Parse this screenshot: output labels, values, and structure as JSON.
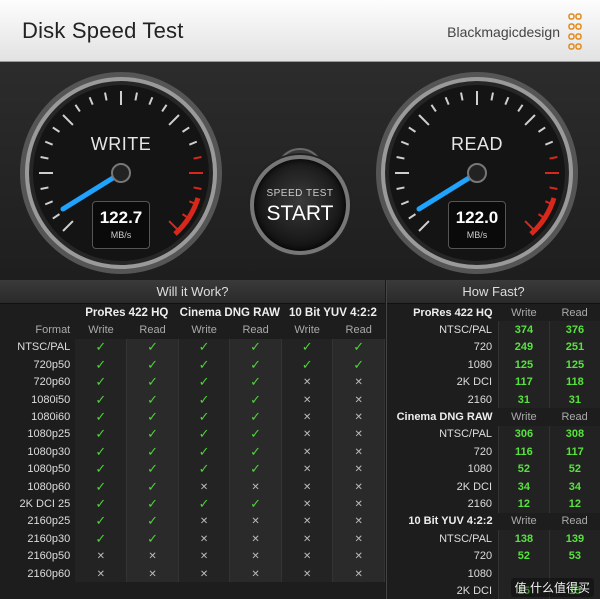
{
  "app": {
    "title": "Disk Speed Test",
    "brand": "Blackmagicdesign"
  },
  "gauges": {
    "write": {
      "label": "WRITE",
      "value": "122.7",
      "unit": "MB/s"
    },
    "read": {
      "label": "READ",
      "value": "122.0",
      "unit": "MB/s"
    }
  },
  "start_button": {
    "small_label": "SPEED TEST",
    "big_label": "START"
  },
  "will_it_work": {
    "title": "Will it Work?",
    "groups": [
      "ProRes 422 HQ",
      "Cinema DNG RAW",
      "10 Bit YUV 4:2:2"
    ],
    "format_header": "Format",
    "write_header": "Write",
    "read_header": "Read",
    "rows": [
      {
        "format": "NTSC/PAL",
        "cells": [
          1,
          1,
          1,
          1,
          1,
          1
        ]
      },
      {
        "format": "720p50",
        "cells": [
          1,
          1,
          1,
          1,
          1,
          1
        ]
      },
      {
        "format": "720p60",
        "cells": [
          1,
          1,
          1,
          1,
          0,
          0
        ]
      },
      {
        "format": "1080i50",
        "cells": [
          1,
          1,
          1,
          1,
          0,
          0
        ]
      },
      {
        "format": "1080i60",
        "cells": [
          1,
          1,
          1,
          1,
          0,
          0
        ]
      },
      {
        "format": "1080p25",
        "cells": [
          1,
          1,
          1,
          1,
          0,
          0
        ]
      },
      {
        "format": "1080p30",
        "cells": [
          1,
          1,
          1,
          1,
          0,
          0
        ]
      },
      {
        "format": "1080p50",
        "cells": [
          1,
          1,
          1,
          1,
          0,
          0
        ]
      },
      {
        "format": "1080p60",
        "cells": [
          1,
          1,
          0,
          0,
          0,
          0
        ]
      },
      {
        "format": "2K DCI 25",
        "cells": [
          1,
          1,
          1,
          1,
          0,
          0
        ]
      },
      {
        "format": "2160p25",
        "cells": [
          1,
          1,
          0,
          0,
          0,
          0
        ]
      },
      {
        "format": "2160p30",
        "cells": [
          1,
          1,
          0,
          0,
          0,
          0
        ]
      },
      {
        "format": "2160p50",
        "cells": [
          0,
          0,
          0,
          0,
          0,
          0
        ]
      },
      {
        "format": "2160p60",
        "cells": [
          0,
          0,
          0,
          0,
          0,
          0
        ]
      }
    ]
  },
  "how_fast": {
    "title": "How Fast?",
    "write_header": "Write",
    "read_header": "Read",
    "groups": [
      {
        "name": "ProRes 422 HQ",
        "rows": [
          {
            "format": "NTSC/PAL",
            "write": "374",
            "read": "376"
          },
          {
            "format": "720",
            "write": "249",
            "read": "251"
          },
          {
            "format": "1080",
            "write": "125",
            "read": "125"
          },
          {
            "format": "2K DCI",
            "write": "117",
            "read": "118"
          },
          {
            "format": "2160",
            "write": "31",
            "read": "31"
          }
        ]
      },
      {
        "name": "Cinema DNG RAW",
        "rows": [
          {
            "format": "NTSC/PAL",
            "write": "306",
            "read": "308"
          },
          {
            "format": "720",
            "write": "116",
            "read": "117"
          },
          {
            "format": "1080",
            "write": "52",
            "read": "52"
          },
          {
            "format": "2K DCI",
            "write": "34",
            "read": "34"
          },
          {
            "format": "2160",
            "write": "12",
            "read": "12"
          }
        ]
      },
      {
        "name": "10 Bit YUV 4:2:2",
        "rows": [
          {
            "format": "NTSC/PAL",
            "write": "138",
            "read": "139"
          },
          {
            "format": "720",
            "write": "52",
            "read": "53"
          },
          {
            "format": "1080",
            "write": "",
            "read": ""
          },
          {
            "format": "2K DCI",
            "write": "15",
            "read": "15"
          }
        ]
      }
    ]
  },
  "watermark": "值 什么值得买",
  "colors": {
    "check": "#4fd23a",
    "value": "#58e23f",
    "needle": "#1fa3ff",
    "redzone": "#d8281c"
  }
}
